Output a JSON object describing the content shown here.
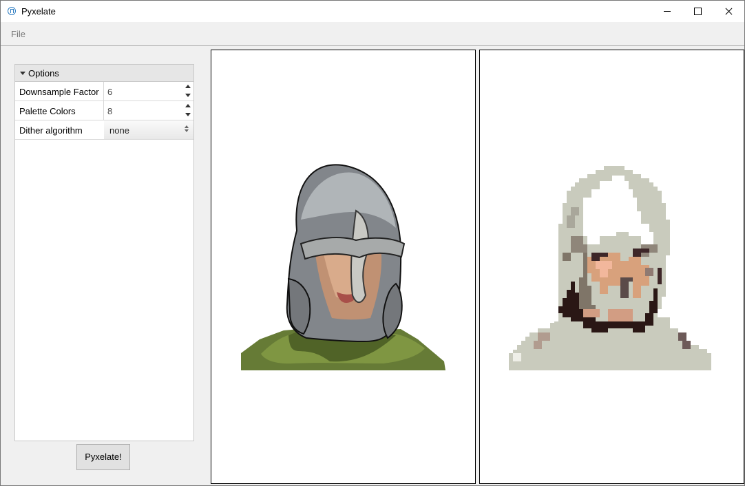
{
  "window": {
    "title": "Pyxelate",
    "controls": [
      "minimize",
      "maximize",
      "close"
    ]
  },
  "menu": {
    "items": [
      "File"
    ]
  },
  "options": {
    "header": "Options",
    "fields": [
      {
        "label": "Downsample Factor",
        "value": "6"
      },
      {
        "label": "Palette Colors",
        "value": "8"
      },
      {
        "label": "Dither algorithm",
        "value": "none"
      }
    ]
  },
  "actions": {
    "pyxelate_label": "Pyxelate!"
  },
  "icons": {
    "app": "pyxelate-app-icon",
    "expand": "triangle-down-icon",
    "spinner": "spinbox-arrows-icon",
    "select": "select-arrows-icon"
  },
  "colors": {
    "panel_border": "#c8c8c8",
    "image_border": "#000000",
    "button_bg": "#e1e1e1"
  }
}
